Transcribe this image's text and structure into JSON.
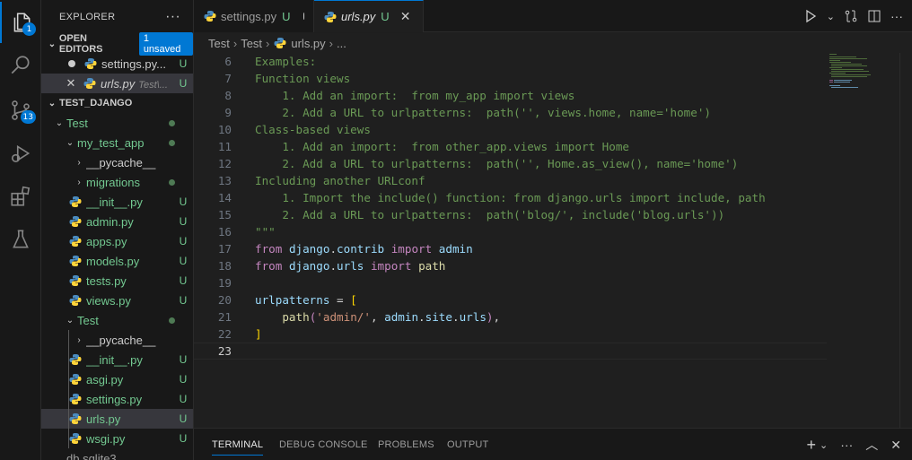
{
  "activity_bar": {
    "explorer_badge": "1",
    "scm_badge": "13"
  },
  "sidebar": {
    "title": "EXPLORER",
    "more": "···",
    "open_editors": {
      "title": "OPEN EDITORS",
      "badge": "1 unsaved",
      "items": [
        {
          "name": "settings.py...",
          "status": "U"
        },
        {
          "name": "urls.py",
          "hint": "Test\\...",
          "status": "U"
        }
      ]
    },
    "project": {
      "title": "TEST_DJANGO",
      "tree": {
        "test_folder": "Test",
        "my_test_app": "my_test_app",
        "pycache_1": "__pycache__",
        "migrations": "migrations",
        "init_1": "__init__.py",
        "admin": "admin.py",
        "apps": "apps.py",
        "models": "models.py",
        "tests": "tests.py",
        "views": "views.py",
        "test_inner": "Test",
        "pycache_2": "__pycache__",
        "init_2": "__init__.py",
        "asgi": "asgi.py",
        "settings": "settings.py",
        "urls": "urls.py",
        "wsgi": "wsgi.py",
        "db": "db.sqlite3",
        "status_u": "U"
      }
    }
  },
  "tabs": [
    {
      "label": "settings.py",
      "status": "U"
    },
    {
      "label": "urls.py",
      "status": "U",
      "close": "✕"
    }
  ],
  "breadcrumb": [
    "Test",
    "Test",
    "urls.py",
    "..."
  ],
  "editor": {
    "line_numbers": [
      "6",
      "7",
      "8",
      "9",
      "10",
      "11",
      "12",
      "13",
      "14",
      "15",
      "16",
      "17",
      "18",
      "19",
      "20",
      "21",
      "22",
      "23"
    ],
    "lines": {
      "l6": "Examples:",
      "l7": "Function views",
      "l8": "    1. Add an import:  from my_app import views",
      "l9": "    2. Add a URL to urlpatterns:  path('', views.home, name='home')",
      "l10": "Class-based views",
      "l11": "    1. Add an import:  from other_app.views import Home",
      "l12": "    2. Add a URL to urlpatterns:  path('', Home.as_view(), name='home')",
      "l13": "Including another URLconf",
      "l14": "    1. Import the include() function: from django.urls import include, path",
      "l15": "    2. Add a URL to urlpatterns:  path('blog/', include('blog.urls'))",
      "l16": "\"\"\"",
      "l17_from": "from",
      "l17_mod1": "django",
      "l17_mod2": "contrib",
      "l17_imp": "import",
      "l17_name": "admin",
      "l18_mod2": "urls",
      "l18_name": "path",
      "l20_var": "urlpatterns",
      "l20_eq": " = ",
      "l20_br": "[",
      "l21_fn": "path",
      "l21_str": "'admin/'",
      "l21_obj": "admin",
      "l21_attr1": "site",
      "l21_attr2": "urls",
      "l22_br": "]"
    }
  },
  "panel": {
    "tabs": [
      "TERMINAL",
      "DEBUG CONSOLE",
      "PROBLEMS",
      "OUTPUT"
    ],
    "active": "TERMINAL"
  },
  "colors": {
    "accent": "#0078d4",
    "untracked": "#73c991",
    "comment": "#6a9955",
    "keyword": "#c586c0",
    "string": "#ce9178"
  }
}
